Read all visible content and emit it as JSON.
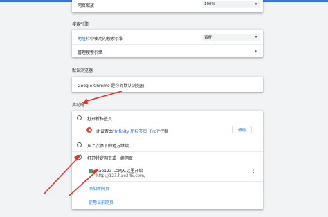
{
  "page_zoom": {
    "label": "网页缩放",
    "value": "100%"
  },
  "search_engine": {
    "section_title": "搜索引擎",
    "address_bar_prefix": "地址栏",
    "address_bar_suffix": "中使用的搜索引擎",
    "engine_value": "百度",
    "manage_label": "管理搜索引擎"
  },
  "default_browser": {
    "section_title": "默认浏览器",
    "status_text": "Google Chrome 是你的默认浏览器"
  },
  "on_startup": {
    "section_title": "启动时",
    "option_newtab": "打开新标签页",
    "extension_notice_prefix": "此设置由",
    "extension_notice_link": "\"Infinity 新标签页 (Pro)\"",
    "extension_notice_suffix": "控制",
    "disable_button": "停用",
    "option_continue": "从上次停下的地方继续",
    "option_specific": "打开特定网页或一组网页",
    "page_title": "hao123_上网从这里开始",
    "page_url": "http://123.hao245.com/",
    "add_page_link": "添加新网页",
    "use_current_link": "使用当前网页"
  },
  "colors": {
    "accent": "#1a73e8",
    "arrow": "#e3342f"
  }
}
